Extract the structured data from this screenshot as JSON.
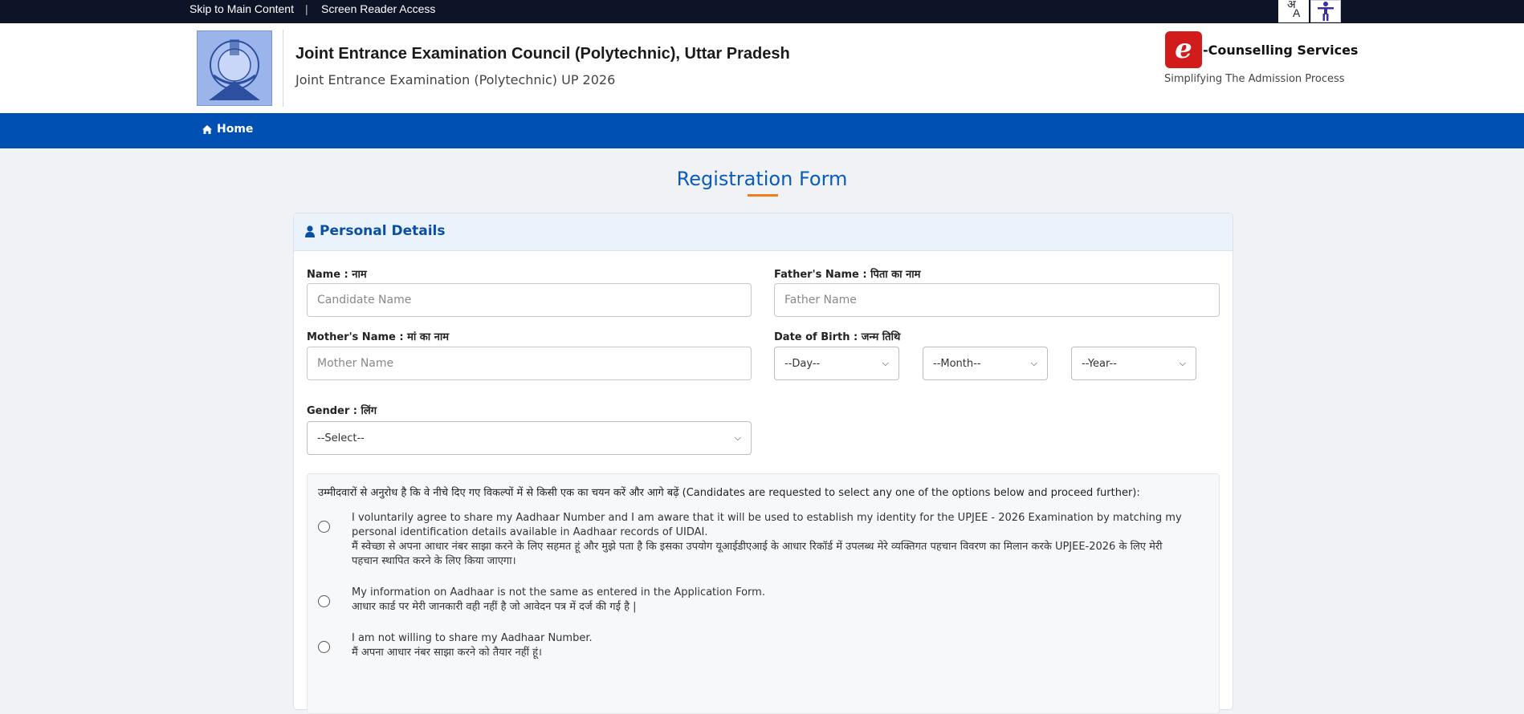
{
  "topbar": {
    "skip_label": "Skip to Main Content",
    "separator": "|",
    "reader_label": "Screen Reader Access",
    "lang_char_top": "अ",
    "lang_char_bottom": "A"
  },
  "header": {
    "title": "Joint Entrance Examination Council (Polytechnic), Uttar Pradesh",
    "subtitle": "Joint Entrance Examination (Polytechnic) UP 2026",
    "brand_letter": "e",
    "brand_name": "-Counselling Services",
    "brand_tagline": "Simplifying The Admission Process"
  },
  "nav": {
    "home_label": "Home"
  },
  "page": {
    "title": "Registration Form"
  },
  "personal": {
    "heading": "Personal Details",
    "name_label": "Name : नाम",
    "name_placeholder": "Candidate Name",
    "father_label": "Father's Name : पिता का नाम",
    "father_placeholder": "Father Name",
    "mother_label": "Mother's Name : मां का नाम",
    "mother_placeholder": "Mother Name",
    "dob_label": "Date of Birth : जन्म तिथि",
    "dob_day": "--Day--",
    "dob_month": "--Month--",
    "dob_year": "--Year--",
    "gender_label": "Gender : लिंग",
    "gender_value": "--Select--"
  },
  "consent": {
    "question": "उम्मीदवारों से अनुरोध है कि वे नीचे दिए गए विकल्पों में से किसी एक का चयन करें और आगे बढ़ें (Candidates are requested to select any one of the options below and proceed further):",
    "options": [
      {
        "en": "I voluntarily agree to share my Aadhaar Number and I am aware that it will be used to establish my identity for the UPJEE - 2026 Examination by matching my personal identification details available in Aadhaar records of UIDAI.",
        "hi": "मैं स्वेच्छा से अपना आधार नंबर साझा करने के लिए सहमत हूं और मुझे पता है कि इसका उपयोग यूआईडीएआई के आधार रिकॉर्ड में उपलब्ध मेरे व्यक्तिगत पहचान विवरण का मिलान करके UPJEE-2026 के लिए मेरी पहचान स्थापित करने के लिए किया जाएगा।"
      },
      {
        "en": "My information on Aadhaar is not the same as entered in the Application Form.",
        "hi": "आधार कार्ड पर मेरी जानकारी वही नहीं है जो आवेदन पत्र में दर्ज की गई है |"
      },
      {
        "en": "I am not willing to share my Aadhaar Number.",
        "hi": "मैं अपना आधार नंबर साझा करने को तैयार नहीं हूं।"
      }
    ]
  },
  "icons": {
    "home": "home-icon",
    "user": "user-icon",
    "accessibility": "accessibility-icon",
    "chevron": "chevron-down-icon"
  },
  "colors": {
    "topbar": "#0d1428",
    "nav": "#0050b3",
    "title": "#0a5bbf",
    "accent": "#f07d1a"
  }
}
